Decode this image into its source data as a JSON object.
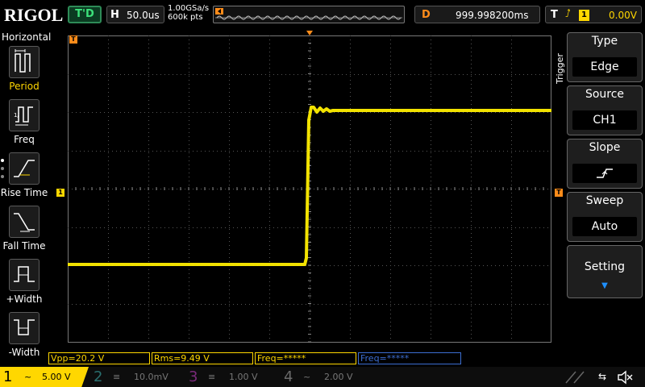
{
  "brand": "RIGOL",
  "run_state": "T'D",
  "horizontal": {
    "key": "H",
    "timebase": "50.0us",
    "sample_rate": "1.00GSa/s",
    "memory_depth": "600k pts"
  },
  "delay": {
    "key": "D",
    "value": "999.998200ms"
  },
  "trigger_status": {
    "key": "T",
    "channel": "1",
    "level": "0.00V",
    "edge_icon": "rising-edge-icon"
  },
  "left_menu": {
    "title": "Horizontal",
    "items": [
      {
        "label": "Period",
        "icon": "period-icon"
      },
      {
        "label": "Freq",
        "icon": "freq-icon"
      },
      {
        "label": "Rise Time",
        "icon": "rise-time-icon"
      },
      {
        "label": "Fall Time",
        "icon": "fall-time-icon"
      },
      {
        "label": "+Width",
        "icon": "positive-width-icon"
      },
      {
        "label": "-Width",
        "icon": "negative-width-icon"
      }
    ]
  },
  "right_menu": {
    "section_label": "Trigger",
    "type": {
      "title": "Type",
      "value": "Edge"
    },
    "source": {
      "title": "Source",
      "value": "CH1"
    },
    "slope": {
      "title": "Slope",
      "value_icon": "rising-slope-icon"
    },
    "sweep": {
      "title": "Sweep",
      "value": "Auto"
    },
    "setting": {
      "title": "Setting"
    }
  },
  "measurements": [
    {
      "text": "Vpp=20.2 V",
      "color": "#ffd700"
    },
    {
      "text": "Rms=9.49 V",
      "color": "#ffd700"
    },
    {
      "text": "Freq=*****",
      "color": "#ffd700"
    },
    {
      "text": "Freq=*****",
      "color": "#3c6ed2"
    }
  ],
  "channels": [
    {
      "num": "1",
      "coupling": "~",
      "scale": "5.00 V",
      "color": "#ffd700",
      "active": true
    },
    {
      "num": "2",
      "coupling": "≡",
      "scale": "10.0mV",
      "color": "#2a6f6f",
      "active": false
    },
    {
      "num": "3",
      "coupling": "≡",
      "scale": "1.00 V",
      "color": "#7a2a7a",
      "active": false
    },
    {
      "num": "4",
      "coupling": "~",
      "scale": "2.00 V",
      "color": "#6a6a6a",
      "active": false
    }
  ],
  "markers": {
    "trigger_pos": "T",
    "ch1_ground": "1",
    "trigger_level": "T"
  },
  "colors": {
    "trace": "#ffee00",
    "grid": "#555555",
    "accent": "#ff8c1a"
  }
}
